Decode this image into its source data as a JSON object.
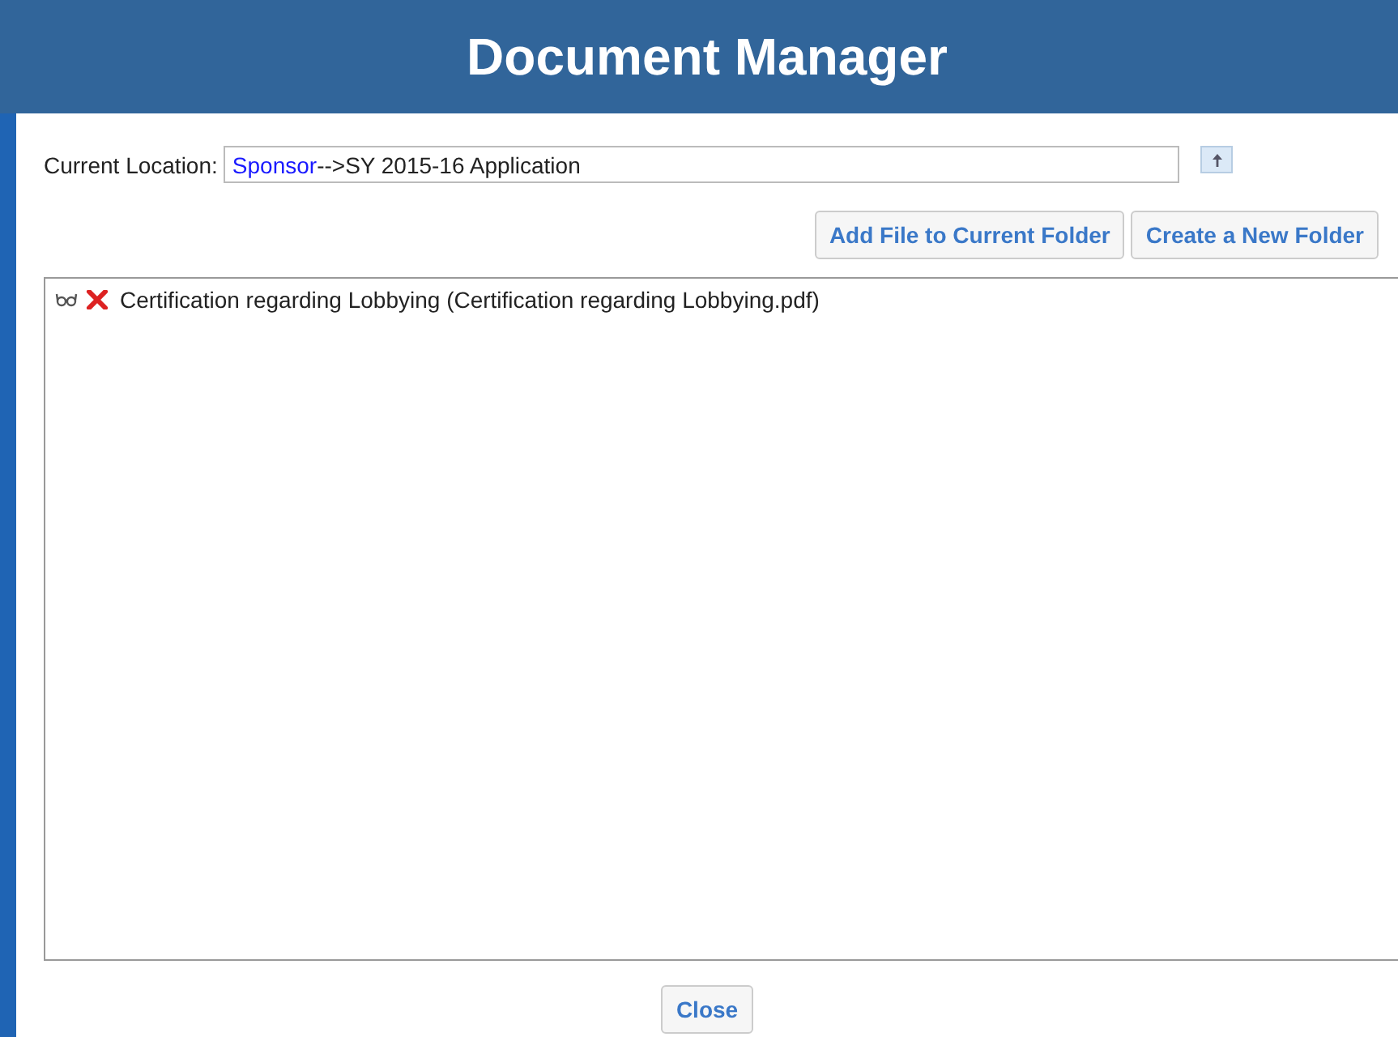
{
  "window": {
    "title": "Document Manager"
  },
  "location": {
    "label": "Current Location:",
    "link": "Sponsor",
    "path": "-->SY 2015-16 Application"
  },
  "toolbar": [
    "Add File to Current Folder",
    "Create a New Folder"
  ],
  "files": [
    {
      "label": "Certification regarding Lobbying (Certification regarding Lobbying.pdf)"
    }
  ],
  "footer": {
    "button": "Close"
  }
}
